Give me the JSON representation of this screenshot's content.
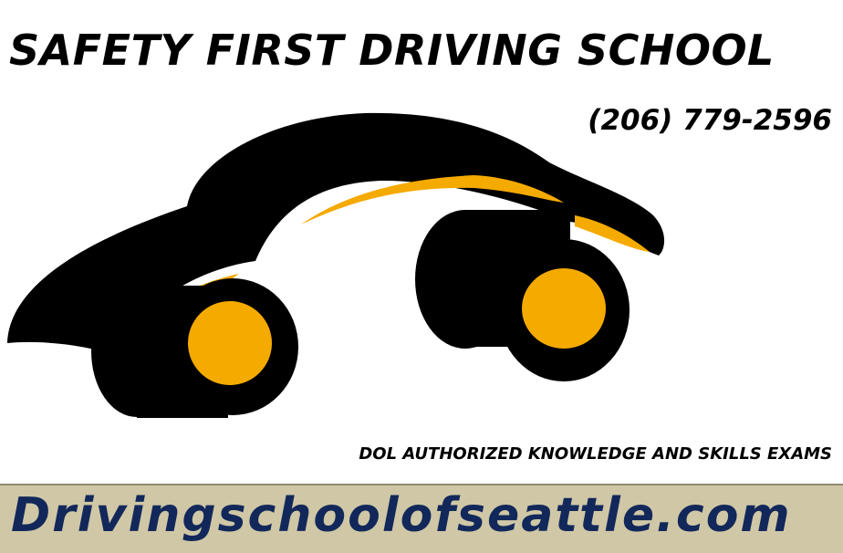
{
  "header": {
    "title": "SAFETY FIRST DRIVING SCHOOL",
    "phone": "(206) 779-2596"
  },
  "logo": {
    "icon": "car-icon",
    "colors": {
      "body": "#000000",
      "accent": "#f5aa00"
    }
  },
  "tagline": "DOL AUTHORIZED KNOWLEDGE AND SKILLS EXAMS",
  "banner": {
    "url": "Drivingschoolofseattle.com",
    "background": "#cfc7a6",
    "text_color": "#12285a"
  }
}
